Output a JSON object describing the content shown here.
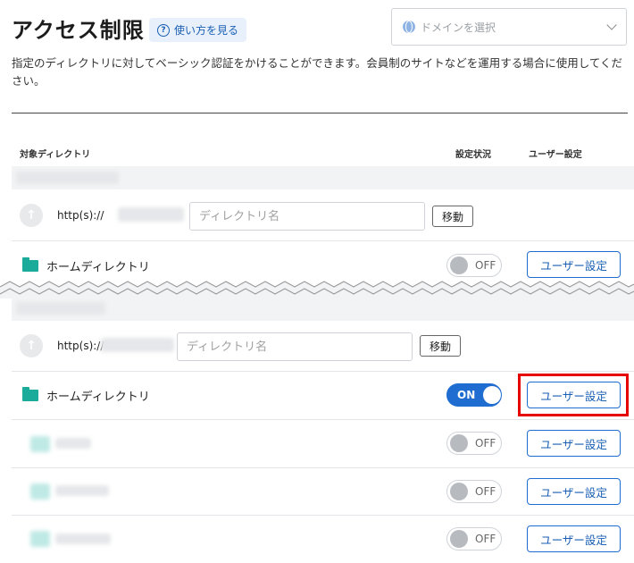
{
  "header": {
    "title": "アクセス制限",
    "howto_label": "使い方を見る",
    "domain_placeholder": "ドメインを選択"
  },
  "description": "指定のディレクトリに対してベーシック認証をかけることができます。会員制のサイトなどを運用する場合に使用してください。",
  "table": {
    "col_directory": "対象ディレクトリ",
    "col_status": "設定状況",
    "col_user": "ユーザー設定"
  },
  "section1": {
    "http_prefix": "http(s)://",
    "dir_placeholder": "ディレクトリ名",
    "move_label": "移動",
    "home_label": "ホームディレクトリ",
    "toggle_label": "OFF",
    "user_label": "ユーザー設定"
  },
  "section2": {
    "http_prefix": "http(s)://",
    "dir_placeholder": "ディレクトリ名",
    "move_label": "移動",
    "home_label": "ホームディレクトリ",
    "home_toggle_label": "ON",
    "user_label": "ユーザー設定",
    "subrows": [
      {
        "toggle_label": "OFF",
        "user_label": "ユーザー設定"
      },
      {
        "toggle_label": "OFF",
        "user_label": "ユーザー設定"
      },
      {
        "toggle_label": "OFF",
        "user_label": "ユーザー設定"
      }
    ]
  },
  "colors": {
    "accent": "#1f6dd1",
    "folder": "#1aab9b",
    "highlight": "#e60000"
  }
}
